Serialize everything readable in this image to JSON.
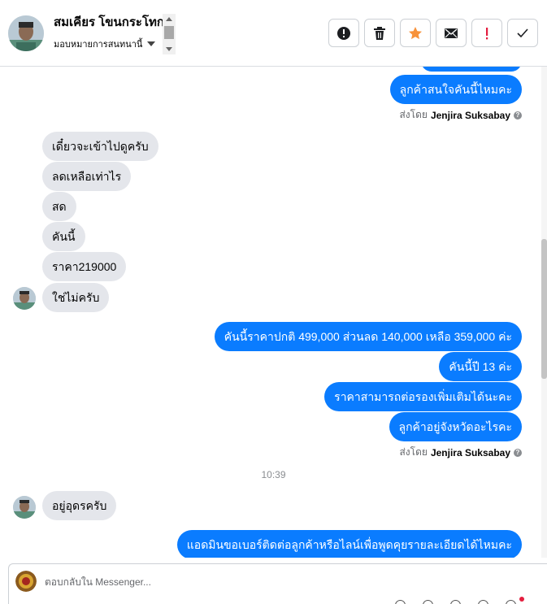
{
  "header": {
    "contact_name": "สมเคียร โขนกระโทก",
    "assign_label": "มอบหมายการสนทนานี้"
  },
  "actions": [
    {
      "name": "mark-spam-button",
      "icon": "alert-circle-icon"
    },
    {
      "name": "delete-button",
      "icon": "trash-icon"
    },
    {
      "name": "star-button",
      "icon": "star-icon",
      "color": "#f7923a"
    },
    {
      "name": "mark-unread-button",
      "icon": "envelope-icon"
    },
    {
      "name": "mark-important-button",
      "icon": "exclamation-icon",
      "color": "#e41e3f"
    },
    {
      "name": "mark-done-button",
      "icon": "check-icon"
    }
  ],
  "conversation": {
    "messages": [
      {
        "dir": "out",
        "text": "ลูกค้าสนใจคันนี้ไหมคะ"
      },
      {
        "dir": "meta",
        "prefix": "ส่งโดย",
        "sender": "Jenjira Suksabay"
      },
      {
        "dir": "in",
        "text": "เดี๋ยวจะเข้าไปดูครับ"
      },
      {
        "dir": "in",
        "text": "ลดเหลือเท่าไร"
      },
      {
        "dir": "in",
        "text": "สด"
      },
      {
        "dir": "in",
        "text": "คันนี้"
      },
      {
        "dir": "in",
        "text": "ราคา219000"
      },
      {
        "dir": "in",
        "text": "ใช่ไม่ครับ"
      },
      {
        "dir": "out",
        "text": "คันนี้ราคาปกติ 499,000 ส่วนลด 140,000 เหลือ 359,000 ค่ะ"
      },
      {
        "dir": "out",
        "text": "คันนี้ปี 13 ค่ะ"
      },
      {
        "dir": "out",
        "text": "ราคาสามารถต่อรองเพิ่มเติมได้นะคะ"
      },
      {
        "dir": "out",
        "text": "ลูกค้าอยู่จังหวัดอะไรคะ"
      },
      {
        "dir": "meta",
        "prefix": "ส่งโดย",
        "sender": "Jenjira Suksabay"
      },
      {
        "dir": "time",
        "text": "10:39"
      },
      {
        "dir": "in",
        "text": "อยู่อุดรครับ"
      },
      {
        "dir": "out",
        "text": "แอดมินขอเบอร์ติดต่อลูกค้าหรือไลน์เพื่อพูดคุยรายละเอียดได้ไหมคะ"
      }
    ]
  },
  "composer": {
    "placeholder": "ตอบกลับใน Messenger..."
  },
  "colors": {
    "outgoing_bubble": "#0a7cff",
    "incoming_bubble": "#e4e6eb",
    "star": "#f7923a",
    "important": "#e41e3f"
  }
}
